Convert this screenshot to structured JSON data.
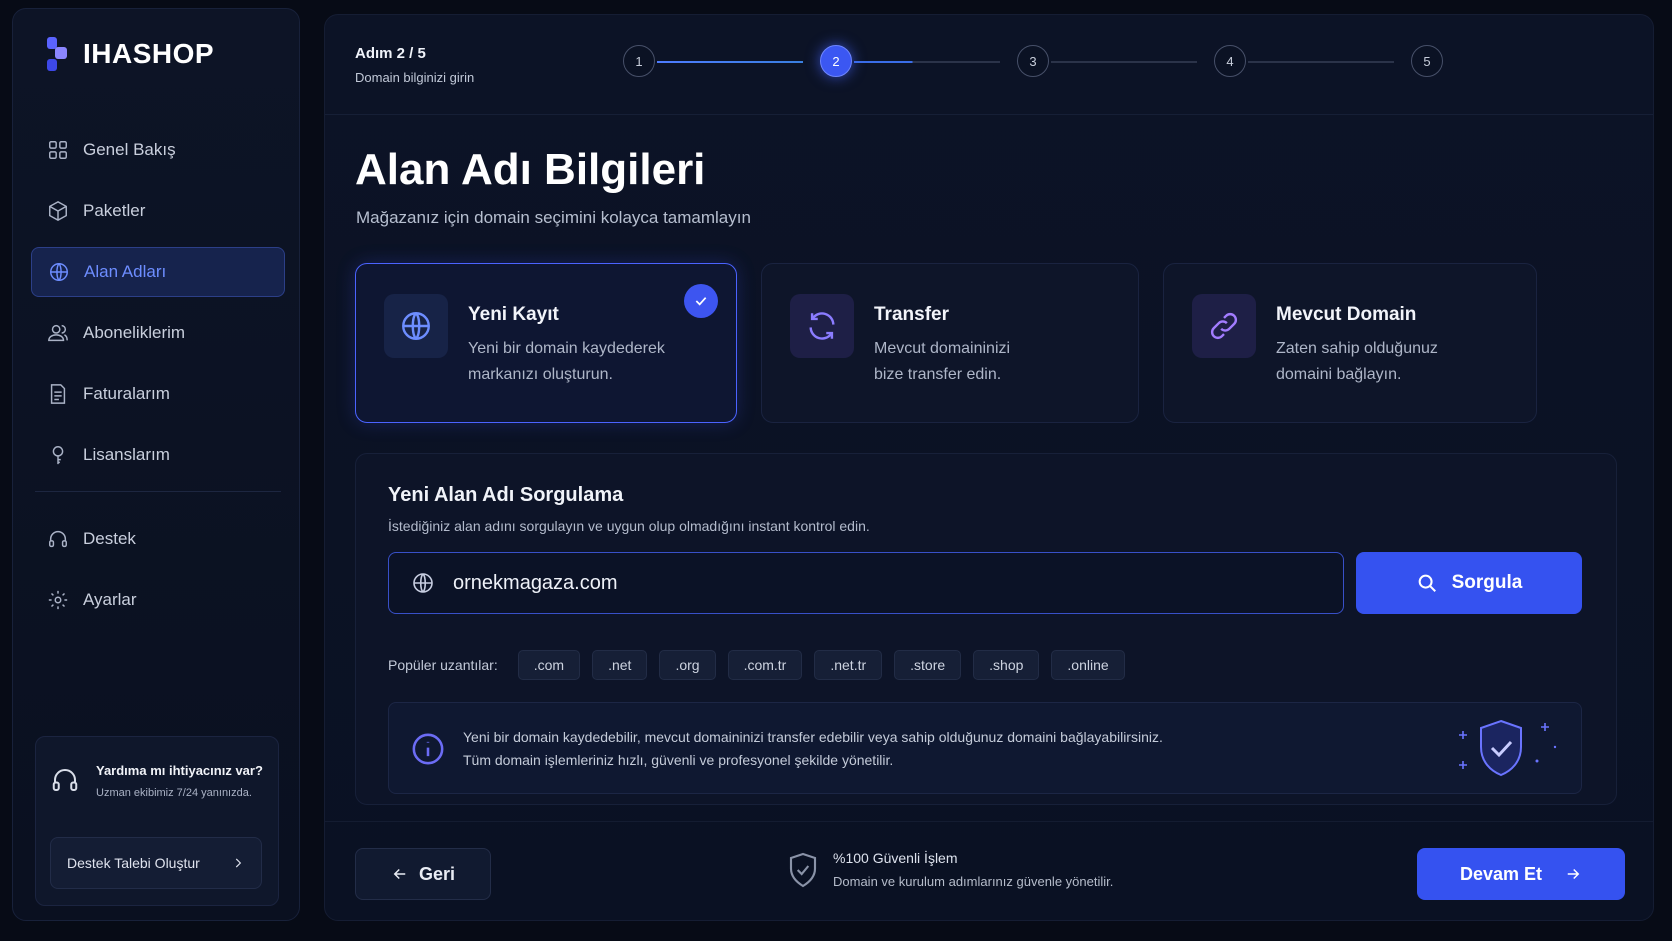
{
  "brand": {
    "name": "IHASHOP"
  },
  "sidebar": {
    "items": [
      {
        "label": "Genel Bakış",
        "icon": "grid-icon"
      },
      {
        "label": "Paketler",
        "icon": "box-icon"
      },
      {
        "label": "Alan Adları",
        "icon": "globe-icon",
        "active": true
      },
      {
        "label": "Aboneliklerim",
        "icon": "users-icon"
      },
      {
        "label": "Faturalarım",
        "icon": "invoice-icon"
      },
      {
        "label": "Lisanslarım",
        "icon": "key-icon"
      }
    ],
    "secondary": [
      {
        "label": "Destek",
        "icon": "headset-icon"
      },
      {
        "label": "Ayarlar",
        "icon": "gear-icon"
      }
    ],
    "help": {
      "title": "Yardıma mı ihtiyacınız var?",
      "subtitle": "Uzman ekibimiz 7/24 yanınızda.",
      "button": "Destek Talebi Oluştur"
    }
  },
  "stepper": {
    "label": "Adım 2 / 5",
    "description": "Domain bilginizi girin",
    "steps": [
      "1",
      "2",
      "3",
      "4",
      "5"
    ],
    "current": 2
  },
  "page": {
    "title": "Alan Adı Bilgileri",
    "subtitle": "Mağazanız için domain seçimini kolayca tamamlayın"
  },
  "options": [
    {
      "title": "Yeni Kayıt",
      "desc_line1": "Yeni bir domain kaydederek",
      "desc_line2": "markanızı oluşturun.",
      "icon": "globe-icon",
      "selected": true
    },
    {
      "title": "Transfer",
      "desc_line1": "Mevcut domaininizi",
      "desc_line2": "bize transfer edin.",
      "icon": "refresh-icon",
      "selected": false
    },
    {
      "title": "Mevcut Domain",
      "desc_line1": "Zaten sahip olduğunuz",
      "desc_line2": "domaini bağlayın.",
      "icon": "link-icon",
      "selected": false
    }
  ],
  "query": {
    "title": "Yeni Alan Adı Sorgulama",
    "subtitle": "İstediğiniz alan adını sorgulayın ve uygun olup olmadığını instant kontrol edin.",
    "input_value": "ornekmagaza.com",
    "button": "Sorgula",
    "ext_label": "Popüler uzantılar:",
    "extensions": [
      ".com",
      ".net",
      ".org",
      ".com.tr",
      ".net.tr",
      ".store",
      ".shop",
      ".online"
    ],
    "info_line1": "Yeni bir domain kaydedebilir, mevcut domaininizi transfer edebilir veya sahip olduğunuz domaini bağlayabilirsiniz.",
    "info_line2": "Tüm domain işlemleriniz hızlı, güvenli ve profesyonel şekilde yönetilir."
  },
  "footer": {
    "back": "Geri",
    "secure_title": "%100 Güvenli İşlem",
    "secure_sub": "Domain ve kurulum adımlarınız güvenle yönetilir.",
    "next": "Devam Et"
  },
  "colors": {
    "accent": "#3552f0",
    "active_nav": "#6d8dff",
    "background": "#070b16"
  }
}
